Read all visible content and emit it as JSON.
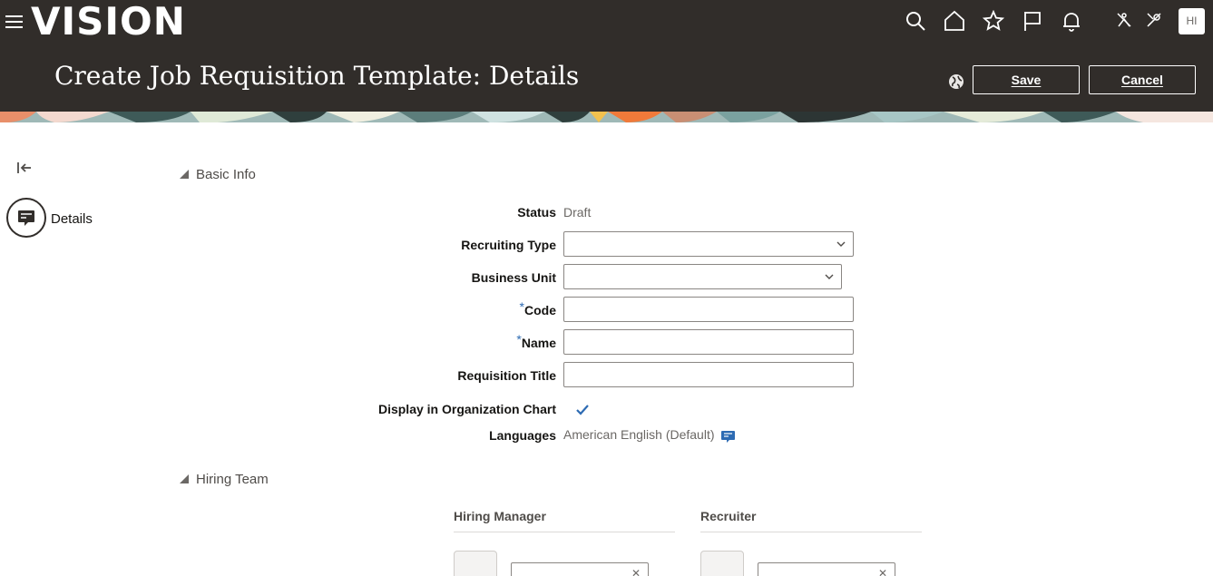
{
  "header": {
    "logo": "VISION",
    "page_title": "Create Job Requisition Template: Details",
    "avatar_initials": "HI",
    "save_label": "Save",
    "cancel_label": "Cancel",
    "icons": [
      "search-icon",
      "home-icon",
      "favorites-star-icon",
      "flag-icon",
      "notifications-bell-icon",
      "accessibility-icon",
      "tools-icon"
    ]
  },
  "nav": {
    "details_label": "Details"
  },
  "sections": {
    "basic_info": "Basic Info",
    "hiring_team": "Hiring Team"
  },
  "form": {
    "status_label": "Status",
    "status_value": "Draft",
    "recruiting_type_label": "Recruiting Type",
    "recruiting_type_value": "",
    "business_unit_label": "Business Unit",
    "business_unit_value": "",
    "required_marker": "*",
    "code_label": "Code",
    "code_value": "",
    "name_label": "Name",
    "name_value": "",
    "requisition_title_label": "Requisition Title",
    "requisition_title_value": "",
    "display_org_chart_label": "Display in Organization Chart",
    "display_org_chart_checked": true,
    "languages_label": "Languages",
    "languages_value": "American English (Default)"
  },
  "hiring_team": {
    "hiring_manager_label": "Hiring Manager",
    "recruiter_label": "Recruiter"
  },
  "colors": {
    "header_bg": "#312d2a",
    "accent_blue": "#2d6bb3",
    "text_muted": "#6b6865"
  }
}
